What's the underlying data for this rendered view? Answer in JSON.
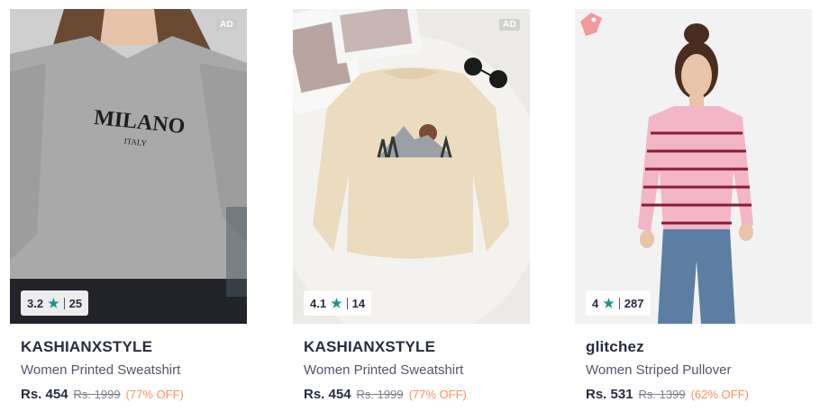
{
  "products": [
    {
      "ad_label": "AD",
      "rating": "3.2",
      "rating_count": "25",
      "brand": "KASHIANXSTYLE",
      "name": "Women Printed Sweatshirt",
      "price": "Rs. 454",
      "mrp": "Rs. 1999",
      "discount": "(77% OFF)",
      "print_main": "MILANO",
      "print_sub": "ITALY"
    },
    {
      "ad_label": "AD",
      "rating": "4.1",
      "rating_count": "14",
      "brand": "KASHIANXSTYLE",
      "name": "Women Printed Sweatshirt",
      "price": "Rs. 454",
      "mrp": "Rs. 1999",
      "discount": "(77% OFF)"
    },
    {
      "rating": "4",
      "rating_count": "287",
      "brand": "glitchez",
      "name": "Women Striped Pullover",
      "price": "Rs. 531",
      "mrp": "Rs. 1399",
      "discount": "(62% OFF)"
    }
  ],
  "icons": {
    "star": "star-icon",
    "tag": "price-tag-icon"
  },
  "colors": {
    "star": "#14958f",
    "discount": "#ff905a",
    "brand_text": "#282c3f"
  }
}
